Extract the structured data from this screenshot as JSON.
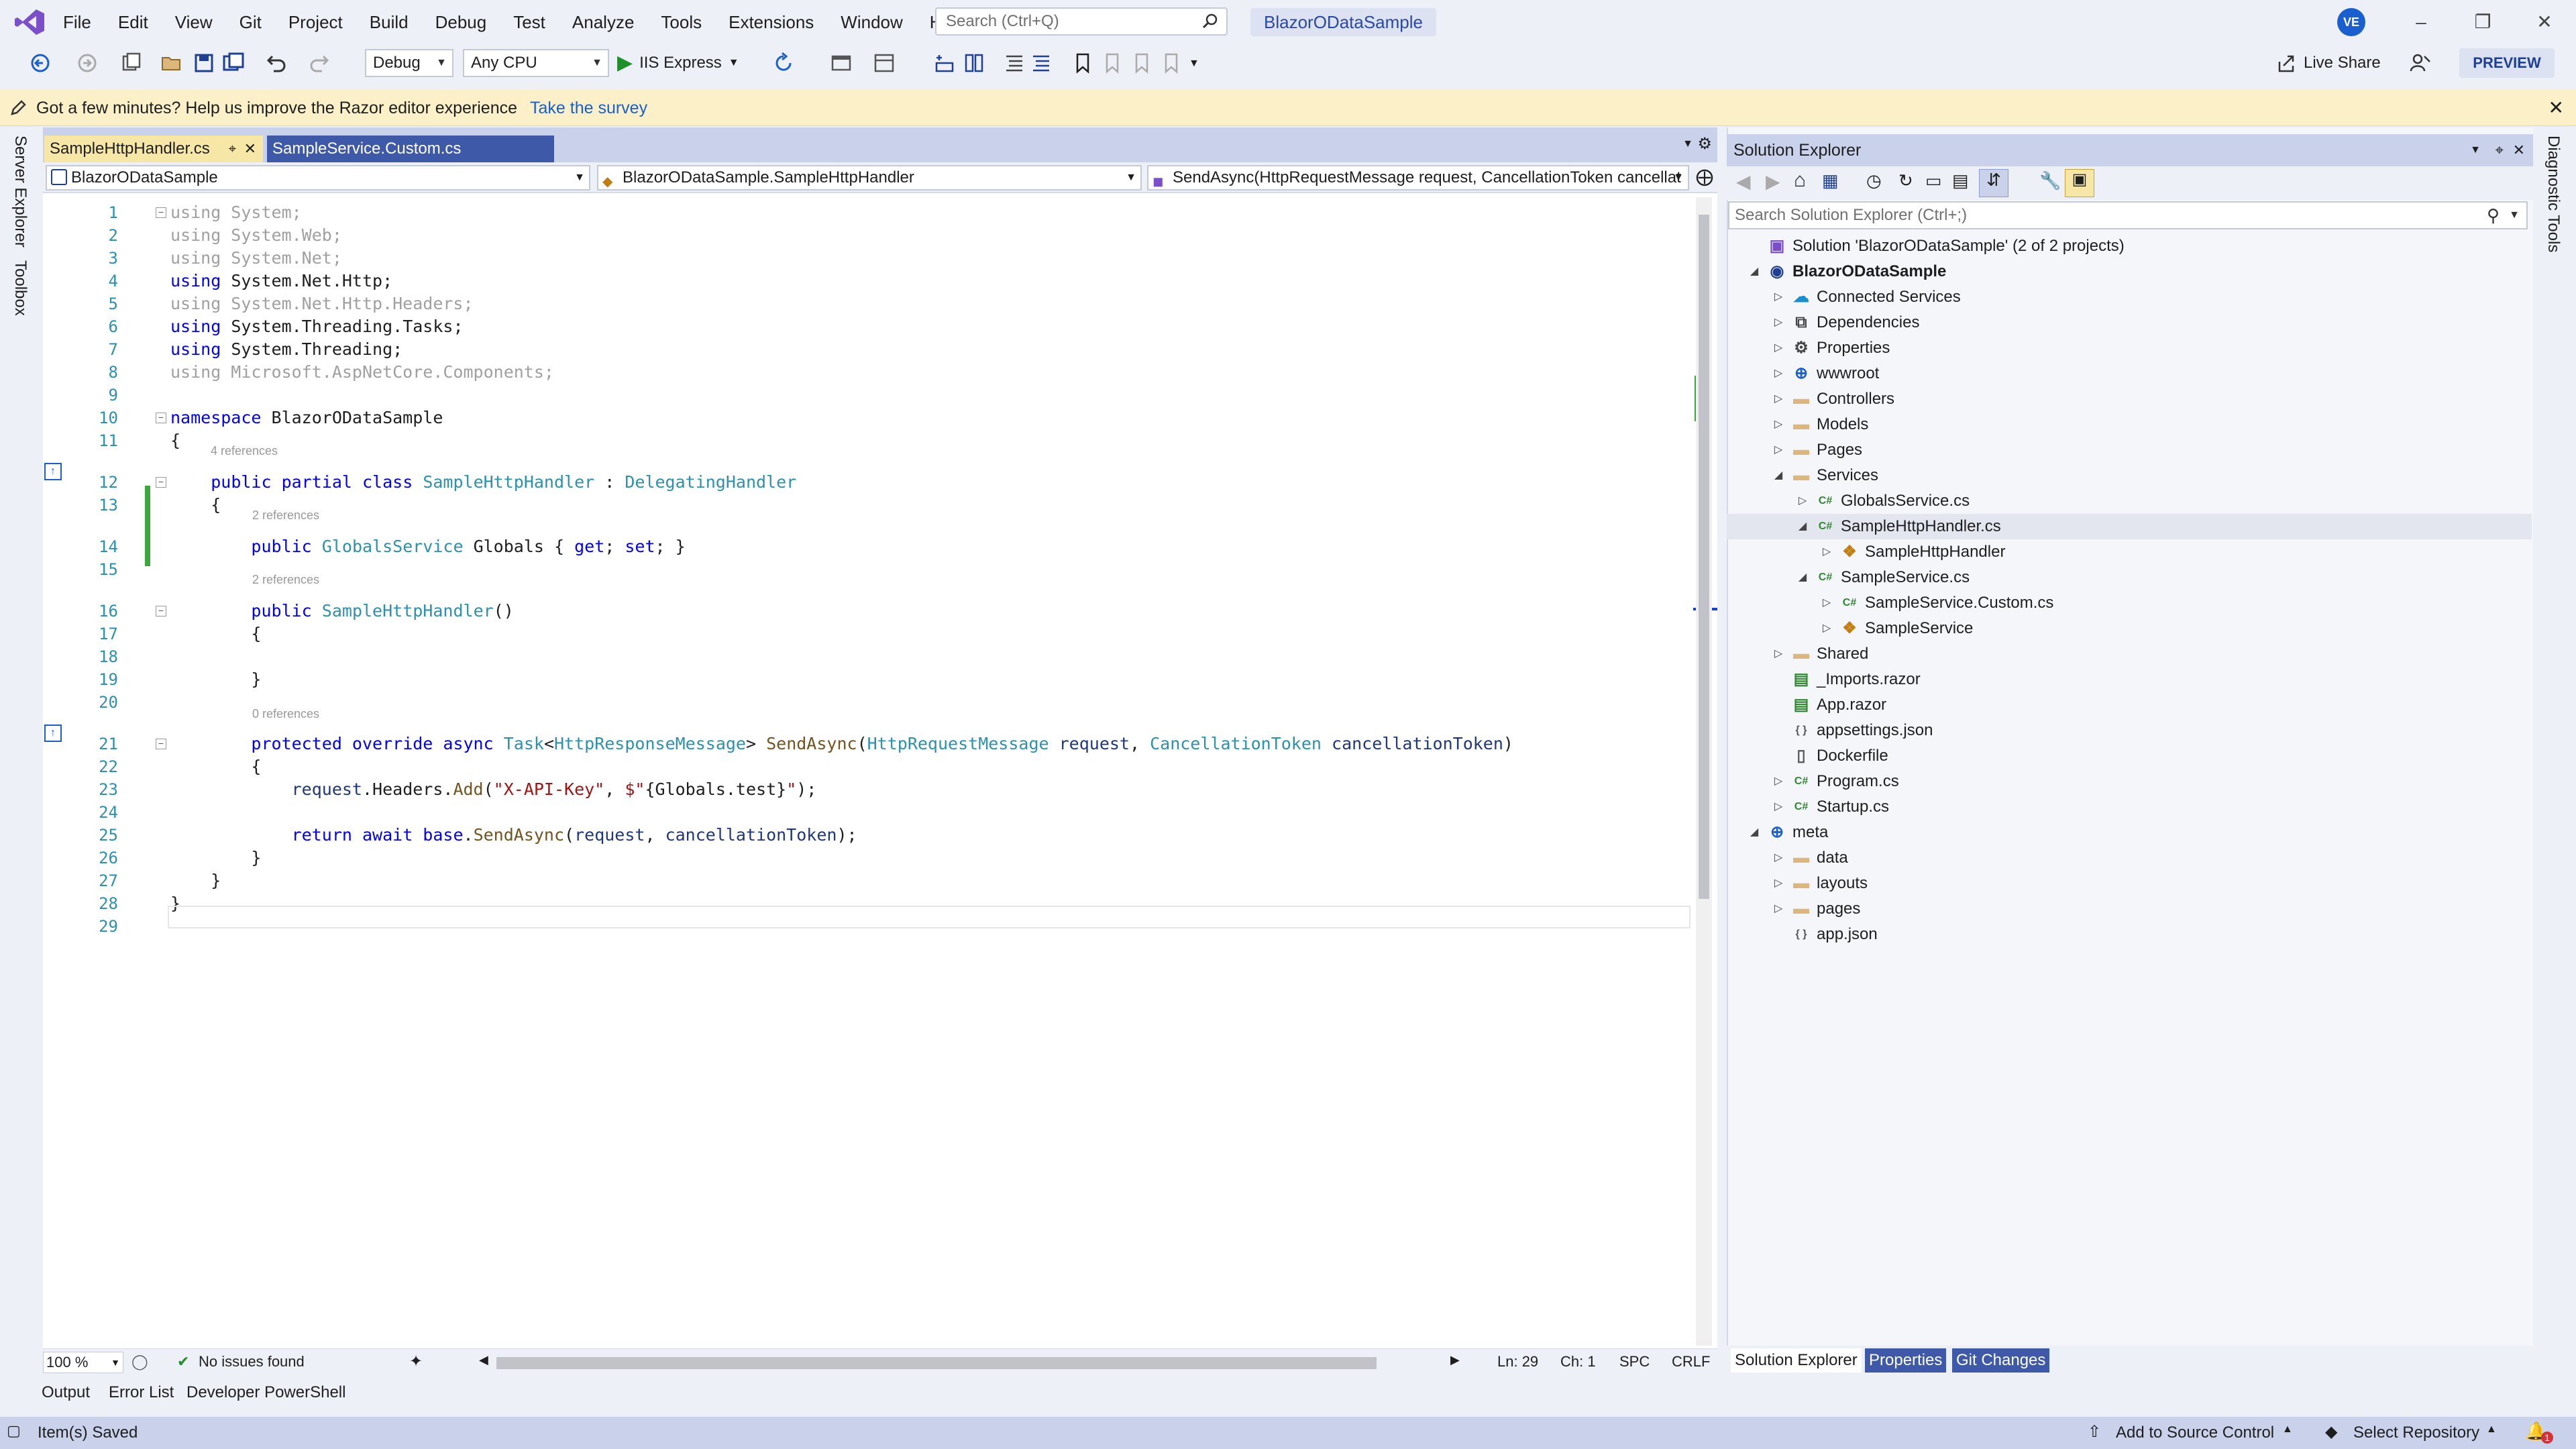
{
  "titlebar": {
    "menu": [
      "File",
      "Edit",
      "View",
      "Git",
      "Project",
      "Build",
      "Debug",
      "Test",
      "Analyze",
      "Tools",
      "Extensions",
      "Window",
      "Help"
    ],
    "search_placeholder": "Search (Ctrl+Q)",
    "solution_name": "BlazorODataSample",
    "avatar_initials": "VE"
  },
  "toolbar": {
    "config": "Debug",
    "platform": "Any CPU",
    "run_label": "IIS Express",
    "live_share": "Live Share",
    "preview": "PREVIEW"
  },
  "infobar": {
    "message": "Got a few minutes? Help us improve the Razor editor experience",
    "link": "Take the survey"
  },
  "left_rail": [
    "Server Explorer",
    "Toolbox"
  ],
  "right_rail": [
    "Diagnostic Tools"
  ],
  "editor": {
    "tabs": [
      {
        "label": "SampleHttpHandler.cs",
        "active": true
      },
      {
        "label": "SampleService.Custom.cs",
        "active": false
      }
    ],
    "nav": {
      "project": "BlazorODataSample",
      "type": "BlazorODataSample.SampleHttpHandler",
      "member": "SendAsync(HttpRequestMessage request, CancellationToken cancellat"
    },
    "codelens": [
      "4 references",
      "2 references",
      "2 references",
      "0 references"
    ],
    "zoom": "100 %",
    "issues": "No issues found",
    "line": "Ln: 29",
    "col": "Ch: 1",
    "spc": "SPC",
    "crlf": "CRLF"
  },
  "code_lines": [
    {
      "n": "1",
      "segs": [
        [
          "dim",
          "using System;"
        ]
      ]
    },
    {
      "n": "2",
      "segs": [
        [
          "dim",
          "using System.Web;"
        ]
      ]
    },
    {
      "n": "3",
      "segs": [
        [
          "dim",
          "using System.Net;"
        ]
      ]
    },
    {
      "n": "4",
      "segs": [
        [
          "kw",
          "using"
        ],
        [
          "pl",
          " System.Net.Http;"
        ]
      ]
    },
    {
      "n": "5",
      "segs": [
        [
          "dim",
          "using System.Net.Http.Headers;"
        ]
      ]
    },
    {
      "n": "6",
      "segs": [
        [
          "kw",
          "using"
        ],
        [
          "pl",
          " System.Threading.Tasks;"
        ]
      ]
    },
    {
      "n": "7",
      "segs": [
        [
          "kw",
          "using"
        ],
        [
          "pl",
          " System.Threading;"
        ]
      ]
    },
    {
      "n": "8",
      "segs": [
        [
          "dim",
          "using Microsoft.AspNetCore.Components;"
        ]
      ]
    },
    {
      "n": "9",
      "segs": []
    },
    {
      "n": "10",
      "segs": [
        [
          "kw",
          "namespace"
        ],
        [
          "pl",
          " BlazorODataSample"
        ]
      ]
    },
    {
      "n": "11",
      "segs": [
        [
          "pl",
          "{"
        ]
      ]
    },
    {
      "n": "12",
      "segs": [
        [
          "pl",
          "    "
        ],
        [
          "kw",
          "public partial class"
        ],
        [
          "pl",
          " "
        ],
        [
          "ty",
          "SampleHttpHandler"
        ],
        [
          "pl",
          " : "
        ],
        [
          "ty",
          "DelegatingHandler"
        ]
      ]
    },
    {
      "n": "13",
      "segs": [
        [
          "pl",
          "    {"
        ]
      ]
    },
    {
      "n": "14",
      "segs": [
        [
          "pl",
          "        "
        ],
        [
          "kw",
          "public"
        ],
        [
          "pl",
          " "
        ],
        [
          "ty",
          "GlobalsService"
        ],
        [
          "pl",
          " Globals { "
        ],
        [
          "kw",
          "get"
        ],
        [
          "pl",
          "; "
        ],
        [
          "kw",
          "set"
        ],
        [
          "pl",
          "; }"
        ]
      ]
    },
    {
      "n": "15",
      "segs": []
    },
    {
      "n": "16",
      "segs": [
        [
          "pl",
          "        "
        ],
        [
          "kw",
          "public"
        ],
        [
          "pl",
          " "
        ],
        [
          "ty",
          "SampleHttpHandler"
        ],
        [
          "pl",
          "()"
        ]
      ]
    },
    {
      "n": "17",
      "segs": [
        [
          "pl",
          "        {"
        ]
      ]
    },
    {
      "n": "18",
      "segs": []
    },
    {
      "n": "19",
      "segs": [
        [
          "pl",
          "        }"
        ]
      ]
    },
    {
      "n": "20",
      "segs": []
    },
    {
      "n": "21",
      "segs": [
        [
          "pl",
          "        "
        ],
        [
          "kw",
          "protected override async"
        ],
        [
          "pl",
          " "
        ],
        [
          "ty",
          "Task"
        ],
        [
          "pl",
          "<"
        ],
        [
          "ty",
          "HttpResponseMessage"
        ],
        [
          "pl",
          "> "
        ],
        [
          "mt",
          "SendAsync"
        ],
        [
          "pl",
          "("
        ],
        [
          "ty",
          "HttpRequestMessage"
        ],
        [
          "pl",
          " "
        ],
        [
          "pa",
          "request"
        ],
        [
          "pl",
          ", "
        ],
        [
          "ty",
          "CancellationToken"
        ],
        [
          "pl",
          " "
        ],
        [
          "pa",
          "cancellationToken"
        ],
        [
          "pl",
          ")"
        ]
      ]
    },
    {
      "n": "22",
      "segs": [
        [
          "pl",
          "        {"
        ]
      ]
    },
    {
      "n": "23",
      "segs": [
        [
          "pl",
          "            "
        ],
        [
          "pa",
          "request"
        ],
        [
          "pl",
          ".Headers."
        ],
        [
          "mt",
          "Add"
        ],
        [
          "pl",
          "("
        ],
        [
          "st",
          "\"X-API-Key\""
        ],
        [
          "pl",
          ", "
        ],
        [
          "st",
          "$\""
        ],
        [
          "pl",
          "{Globals.test}"
        ],
        [
          "st",
          "\""
        ],
        [
          "pl",
          ");"
        ]
      ]
    },
    {
      "n": "24",
      "segs": []
    },
    {
      "n": "25",
      "segs": [
        [
          "pl",
          "            "
        ],
        [
          "kw",
          "return await base"
        ],
        [
          "pl",
          "."
        ],
        [
          "mt",
          "SendAsync"
        ],
        [
          "pl",
          "("
        ],
        [
          "pa",
          "request"
        ],
        [
          "pl",
          ", "
        ],
        [
          "pa",
          "cancellationToken"
        ],
        [
          "pl",
          ");"
        ]
      ]
    },
    {
      "n": "26",
      "segs": [
        [
          "pl",
          "        }"
        ]
      ]
    },
    {
      "n": "27",
      "segs": [
        [
          "pl",
          "    }"
        ]
      ]
    },
    {
      "n": "28",
      "segs": [
        [
          "pl",
          "}"
        ]
      ]
    },
    {
      "n": "29",
      "segs": []
    }
  ],
  "solution_explorer": {
    "title": "Solution Explorer",
    "search_placeholder": "Search Solution Explorer (Ctrl+;)",
    "items": [
      {
        "label": "Solution 'BlazorODataSample' (2 of 2 projects)",
        "depth": 0,
        "exp": "",
        "icon": "solution-icon",
        "bold": false
      },
      {
        "label": "BlazorODataSample",
        "depth": 0,
        "exp": "open",
        "icon": "project-icon",
        "bold": true
      },
      {
        "label": "Connected Services",
        "depth": 1,
        "exp": "closed",
        "icon": "connected-services-icon",
        "bold": false
      },
      {
        "label": "Dependencies",
        "depth": 1,
        "exp": "closed",
        "icon": "dependencies-icon",
        "bold": false
      },
      {
        "label": "Properties",
        "depth": 1,
        "exp": "closed",
        "icon": "properties-icon",
        "bold": false
      },
      {
        "label": "wwwroot",
        "depth": 1,
        "exp": "closed",
        "icon": "globe-icon",
        "bold": false
      },
      {
        "label": "Controllers",
        "depth": 1,
        "exp": "closed",
        "icon": "folder-icon",
        "bold": false
      },
      {
        "label": "Models",
        "depth": 1,
        "exp": "closed",
        "icon": "folder-icon",
        "bold": false
      },
      {
        "label": "Pages",
        "depth": 1,
        "exp": "closed",
        "icon": "folder-icon",
        "bold": false
      },
      {
        "label": "Services",
        "depth": 1,
        "exp": "open",
        "icon": "folder-open-icon",
        "bold": false
      },
      {
        "label": "GlobalsService.cs",
        "depth": 2,
        "exp": "closed",
        "icon": "csharp-file-icon",
        "bold": false
      },
      {
        "label": "SampleHttpHandler.cs",
        "depth": 2,
        "exp": "open",
        "icon": "csharp-file-icon",
        "bold": false,
        "selected": true
      },
      {
        "label": "SampleHttpHandler",
        "depth": 3,
        "exp": "closed",
        "icon": "class-icon",
        "bold": false
      },
      {
        "label": "SampleService.cs",
        "depth": 2,
        "exp": "open",
        "icon": "csharp-file-icon",
        "bold": false
      },
      {
        "label": "SampleService.Custom.cs",
        "depth": 3,
        "exp": "closed",
        "icon": "csharp-file-icon",
        "bold": false
      },
      {
        "label": "SampleService",
        "depth": 3,
        "exp": "closed",
        "icon": "class-icon",
        "bold": false
      },
      {
        "label": "Shared",
        "depth": 1,
        "exp": "closed",
        "icon": "folder-icon",
        "bold": false
      },
      {
        "label": "_Imports.razor",
        "depth": 1,
        "exp": "",
        "icon": "razor-file-icon",
        "bold": false
      },
      {
        "label": "App.razor",
        "depth": 1,
        "exp": "",
        "icon": "razor-file-icon",
        "bold": false
      },
      {
        "label": "appsettings.json",
        "depth": 1,
        "exp": "",
        "icon": "json-file-icon",
        "bold": false
      },
      {
        "label": "Dockerfile",
        "depth": 1,
        "exp": "",
        "icon": "file-icon",
        "bold": false
      },
      {
        "label": "Program.cs",
        "depth": 1,
        "exp": "closed",
        "icon": "csharp-file-icon",
        "bold": false
      },
      {
        "label": "Startup.cs",
        "depth": 1,
        "exp": "closed",
        "icon": "csharp-file-icon",
        "bold": false
      },
      {
        "label": "meta",
        "depth": 0,
        "exp": "open",
        "icon": "globe-icon",
        "bold": false
      },
      {
        "label": "data",
        "depth": 1,
        "exp": "closed",
        "icon": "folder-icon",
        "bold": false
      },
      {
        "label": "layouts",
        "depth": 1,
        "exp": "closed",
        "icon": "folder-icon",
        "bold": false
      },
      {
        "label": "pages",
        "depth": 1,
        "exp": "closed",
        "icon": "folder-icon",
        "bold": false
      },
      {
        "label": "app.json",
        "depth": 1,
        "exp": "",
        "icon": "json-file-icon",
        "bold": false
      }
    ],
    "bottom_tabs": [
      "Solution Explorer",
      "Properties",
      "Git Changes"
    ]
  },
  "output_tabs": [
    "Output",
    "Error List",
    "Developer PowerShell"
  ],
  "statusbar": {
    "left": "Item(s) Saved",
    "source_control": "Add to Source Control",
    "repository": "Select Repository",
    "notifications": "1"
  },
  "colors": {
    "accent": "#3e59a8",
    "keyword": "#0000ff",
    "type": "#2b91af",
    "string": "#a31515",
    "method": "#74531f"
  }
}
